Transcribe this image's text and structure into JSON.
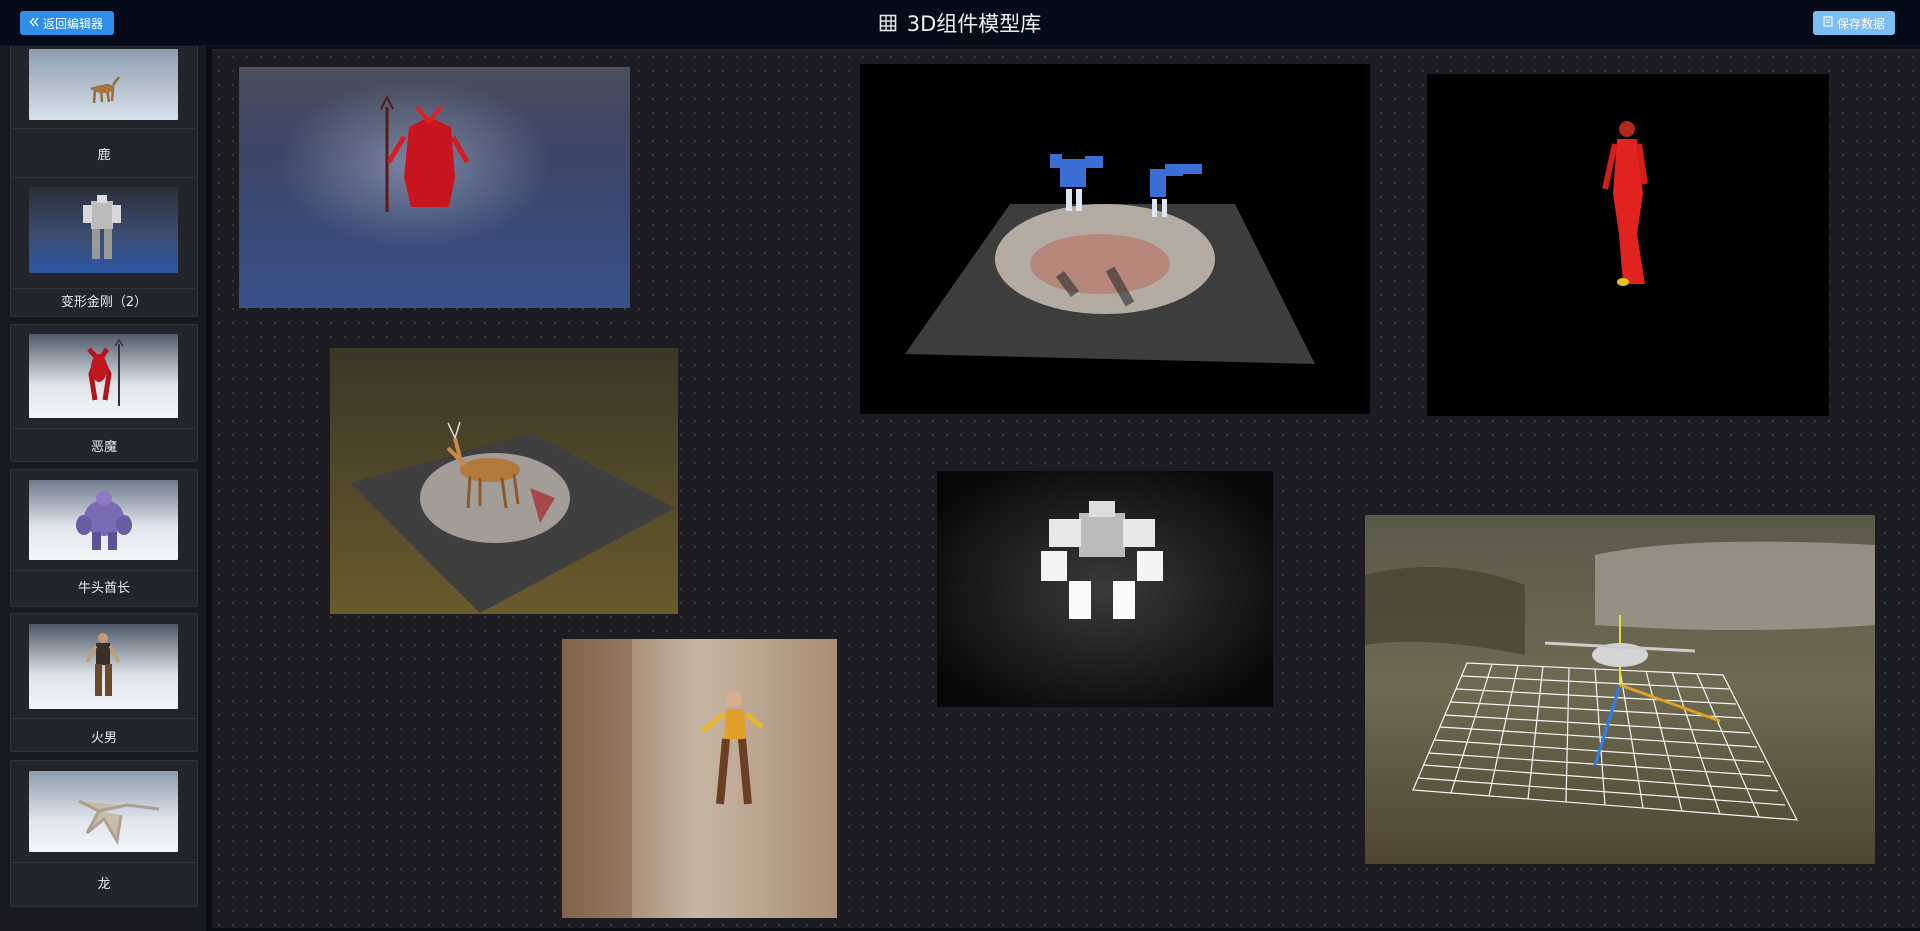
{
  "header": {
    "back_label": "返回编辑器",
    "title": "3D组件模型库",
    "save_label": "保存数据"
  },
  "sidebar": {
    "items": [
      {
        "label": "鹿",
        "icon": "deer-thumbnail"
      },
      {
        "label": "变形金刚（2）",
        "icon": "transformer-thumbnail"
      },
      {
        "label": "恶魔",
        "icon": "demon-thumbnail"
      },
      {
        "label": "牛头酋长",
        "icon": "tauren-chief-thumbnail"
      },
      {
        "label": "火男",
        "icon": "fire-man-thumbnail"
      },
      {
        "label": "龙",
        "icon": "dragon-thumbnail"
      }
    ]
  },
  "canvas": {
    "models": [
      {
        "name": "demon-model-scene"
      },
      {
        "name": "transformers-scene"
      },
      {
        "name": "red-figure-scene"
      },
      {
        "name": "deer-model-scene"
      },
      {
        "name": "fire-man-scene"
      },
      {
        "name": "robot-mech-scene"
      },
      {
        "name": "helicopter-grid-scene"
      }
    ]
  },
  "colors": {
    "header_bg": "#050b19",
    "accent": "#2f8fe8",
    "save_button": "#7cbdf5",
    "sidebar_bg": "#17191f",
    "canvas_bg": "#1c1c22"
  }
}
